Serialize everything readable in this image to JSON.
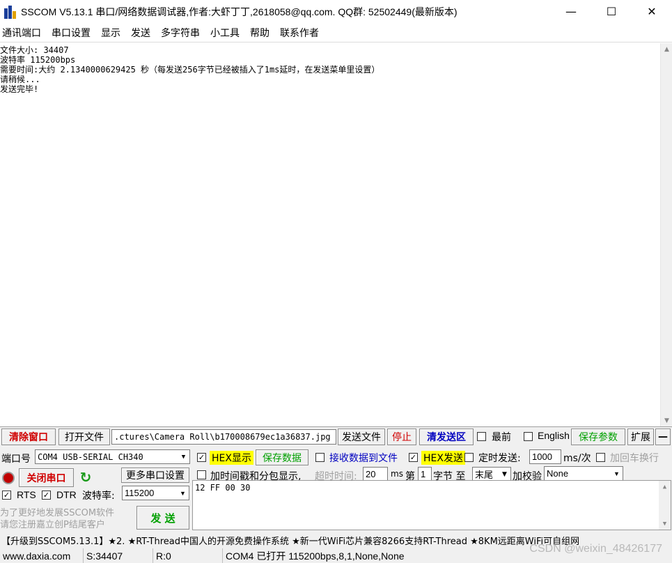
{
  "window": {
    "title": "SSCOM V5.13.1 串口/网络数据调试器,作者:大虾丁丁,2618058@qq.com. QQ群:  52502449(最新版本)",
    "minimize": "—",
    "maximize": "☐",
    "close": "✕"
  },
  "menu": [
    "通讯端口",
    "串口设置",
    "显示",
    "发送",
    "多字符串",
    "小工具",
    "帮助",
    "联系作者"
  ],
  "receive": {
    "lines": [
      "文件大小: 34407",
      "波特率 115200bps",
      "需要时间:大约 2.1340000629425 秒（每发送256字节已经被插入了1ms延时，在发送菜单里设置）",
      "请稍候...",
      "发送完毕!"
    ]
  },
  "toolbar": {
    "clear_window": "清除窗口",
    "open_file": "打开文件",
    "file_path": ".ctures\\Camera Roll\\b170008679ec1a36837.jpg",
    "send_file": "发送文件",
    "stop": "停止",
    "clear_send": "清发送区",
    "front_label": "最前",
    "english_label": "English",
    "save_params": "保存参数",
    "expand": "扩展",
    "collapse": "—"
  },
  "port": {
    "port_label": "端口号",
    "port_value": "COM4 USB-SERIAL CH340",
    "close_port": "关闭串口",
    "more_settings": "更多串口设置",
    "rts": "RTS",
    "dtr": "DTR",
    "baud_label": "波特率:",
    "baud_value": "115200"
  },
  "options": {
    "hex_display": "HEX显示",
    "save_data": "保存数据",
    "recv_to_file": "接收数据到文件",
    "hex_send": "HEX发送",
    "timed_send": "定时发送:",
    "interval": "1000",
    "interval_unit": "ms/次",
    "add_crlf": "加回车换行",
    "timestamp": "加时间戳和分包显示,",
    "timeout_label": "超时时间:",
    "timeout_value": "20",
    "timeout_unit": "ms",
    "byte_prefix": "第",
    "byte_from": "1",
    "byte_mid": "字节 至",
    "byte_to": "末尾",
    "checksum_label": "加校验",
    "checksum_value": "None"
  },
  "send": {
    "content": "12 FF 00 30",
    "button": "发  送",
    "promo_line1": "为了更好地发展SSCOM软件",
    "promo_line2": "请您注册嘉立创P结尾客户"
  },
  "ticker": "【升级到SSCOM5.13.1】★2. ★RT-Thread中国人的开源免费操作系统 ★新一代WiFi芯片兼容8266支持RT-Thread ★8KM远距离WiFi可自组网",
  "status": {
    "website": "www.daxia.com",
    "sent": "S:34407",
    "received": "R:0",
    "port_status": "COM4 已打开  115200bps,8,1,None,None"
  },
  "watermark": "CSDN @weixin_48426177",
  "colors": {
    "accent_red": "#d00000",
    "accent_green": "#00a000",
    "hex_highlight": "#ffff00",
    "panel_bg": "#f0f0f0"
  }
}
